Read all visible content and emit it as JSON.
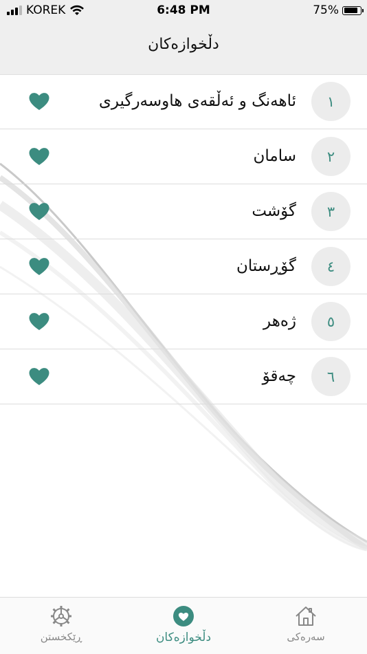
{
  "status_bar": {
    "carrier": "KOREK",
    "time": "6:48 PM",
    "battery": "75%",
    "battery_level": 0.75
  },
  "header": {
    "title": "دڵخوازەکان"
  },
  "favorites": [
    {
      "number": "١",
      "title": "ئاهەنگ و ئەڵقەی هاوسەرگیری"
    },
    {
      "number": "٢",
      "title": "سامان"
    },
    {
      "number": "٣",
      "title": "گۆشت"
    },
    {
      "number": "٤",
      "title": "گۆڕستان"
    },
    {
      "number": "٥",
      "title": "ژەهر"
    },
    {
      "number": "٦",
      "title": "چەقۆ"
    }
  ],
  "tabs": {
    "settings": "ڕێکخستن",
    "favorites": "دڵخوازەکان",
    "home": "سەرەکی"
  },
  "colors": {
    "accent": "#3c8c80",
    "inactive": "#888888",
    "header_bg": "#efefef"
  },
  "icons": {
    "row_action": "heart-icon",
    "tab_settings": "settings-icon",
    "tab_favorites": "heart-icon",
    "tab_home": "home-icon"
  }
}
